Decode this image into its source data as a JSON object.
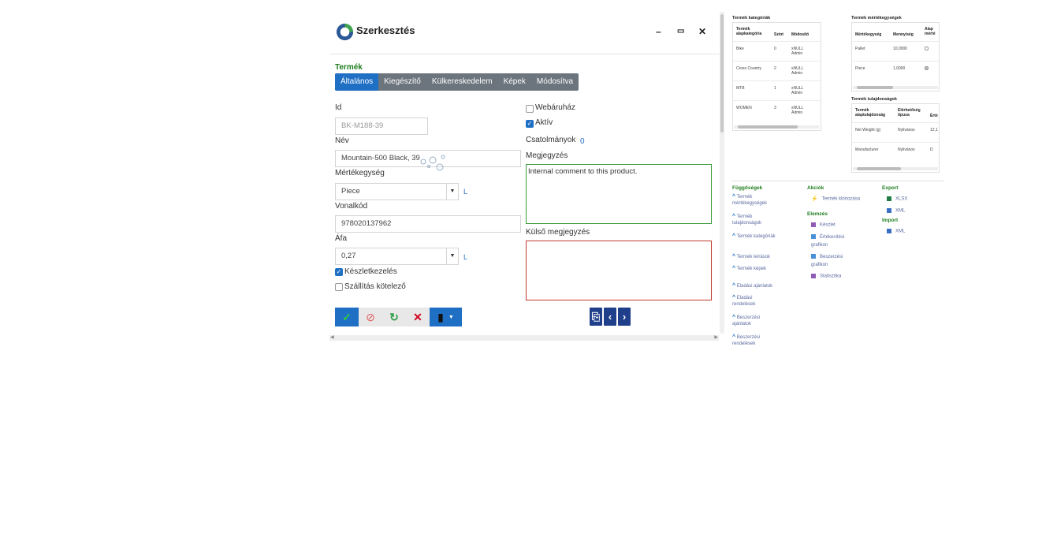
{
  "dialog": {
    "title": "Szerkesztés",
    "window": {
      "minimize": "–",
      "maximize": "▭",
      "close": "✕"
    },
    "section_title": "Termék",
    "tabs": [
      "Általános",
      "Kiegészítő",
      "Külkereskedelem",
      "Képek",
      "Módosítva"
    ],
    "fields": {
      "id_label": "Id",
      "id_value": "BK-M188-39",
      "name_label": "Név",
      "name_value": "Mountain-500 Black, 39",
      "unit_label": "Mértékegység",
      "unit_value": "Piece",
      "barcode_label": "Vonalkód",
      "barcode_value": "978020137962",
      "vat_label": "Áfa",
      "vat_value": "0,27",
      "link_letter": "L",
      "stock_label": "Készletkezelés",
      "shipping_label": "Szállítás kötelező",
      "webshop_label": "Webáruház",
      "active_label": "Aktív",
      "attachments_label": "Csatolmányok",
      "attachments_count": "0",
      "comment_label": "Megjegyzés",
      "comment_value": "Internal comment to this product.",
      "external_comment_label": "Külső megjegyzés",
      "external_comment_value": ""
    },
    "checkboxes": {
      "stock": true,
      "shipping": false,
      "webshop": false,
      "active": true
    },
    "icons": {
      "save": "✓",
      "cancel": "⊘",
      "refresh": "↻",
      "delete": "✕",
      "print": "▮",
      "attach": "⎘",
      "prev": "‹",
      "next": "›"
    }
  },
  "panels": {
    "categories": {
      "title": "Termék kategóriák",
      "headers": [
        "Termék alapkategória",
        "Szint",
        "Módosító"
      ],
      "rows": [
        [
          "Bike",
          "0",
          "xNULL Admin"
        ],
        [
          "Cross Country",
          "2",
          "xNULL Admin"
        ],
        [
          "MTB",
          "1",
          "xNULL Admin"
        ],
        [
          "WOMEN",
          "3",
          "xNULL Admin"
        ]
      ]
    },
    "units": {
      "title": "Termék mértékegységek",
      "headers": [
        "Mértékegység",
        "Mennyiség",
        "Alap mérté"
      ],
      "rows": [
        [
          "Pallet",
          "10,0000"
        ],
        [
          "Piece",
          "1,0000"
        ]
      ]
    },
    "properties": {
      "title": "Termék tulajdonságok",
      "headers": [
        "Termék alaptulajdonság",
        "Elérhetőség típusa",
        "Érté"
      ],
      "rows": [
        [
          "Net Weight (g)",
          "Nyilvános",
          "12,1"
        ],
        [
          "Manufacturer",
          "Nyilvános",
          "D"
        ]
      ]
    }
  },
  "sidebar": {
    "dependencies_title": "Függőségek",
    "dependencies": [
      "Termék mértékegységek",
      "Termék tulajdonságok",
      "Termék kategóriák",
      "Termék leírások",
      "Termék képek",
      "Eladási ajánlatok",
      "Eladási rendelések",
      "Beszerzési ajánlatok",
      "Beszerzési rendelések"
    ],
    "actions_title": "Akciók",
    "clone_label": "Termék klónozása",
    "analysis_title": "Elemzés",
    "analysis": [
      "Készlet",
      "Értékesítési grafikon",
      "Beszerzési grafikon",
      "Statisztika"
    ],
    "export_title": "Export",
    "export": [
      "XLSX",
      "XML"
    ],
    "import_title": "Import",
    "import": [
      "XML"
    ]
  },
  "colors": {
    "primary": "#1f6fc4",
    "tab_bg": "#6c757d",
    "section_green": "#1e7d1e",
    "comment_border": "#3a9a3a",
    "external_border": "#c0392b",
    "nav_button": "#1f3f8a"
  }
}
